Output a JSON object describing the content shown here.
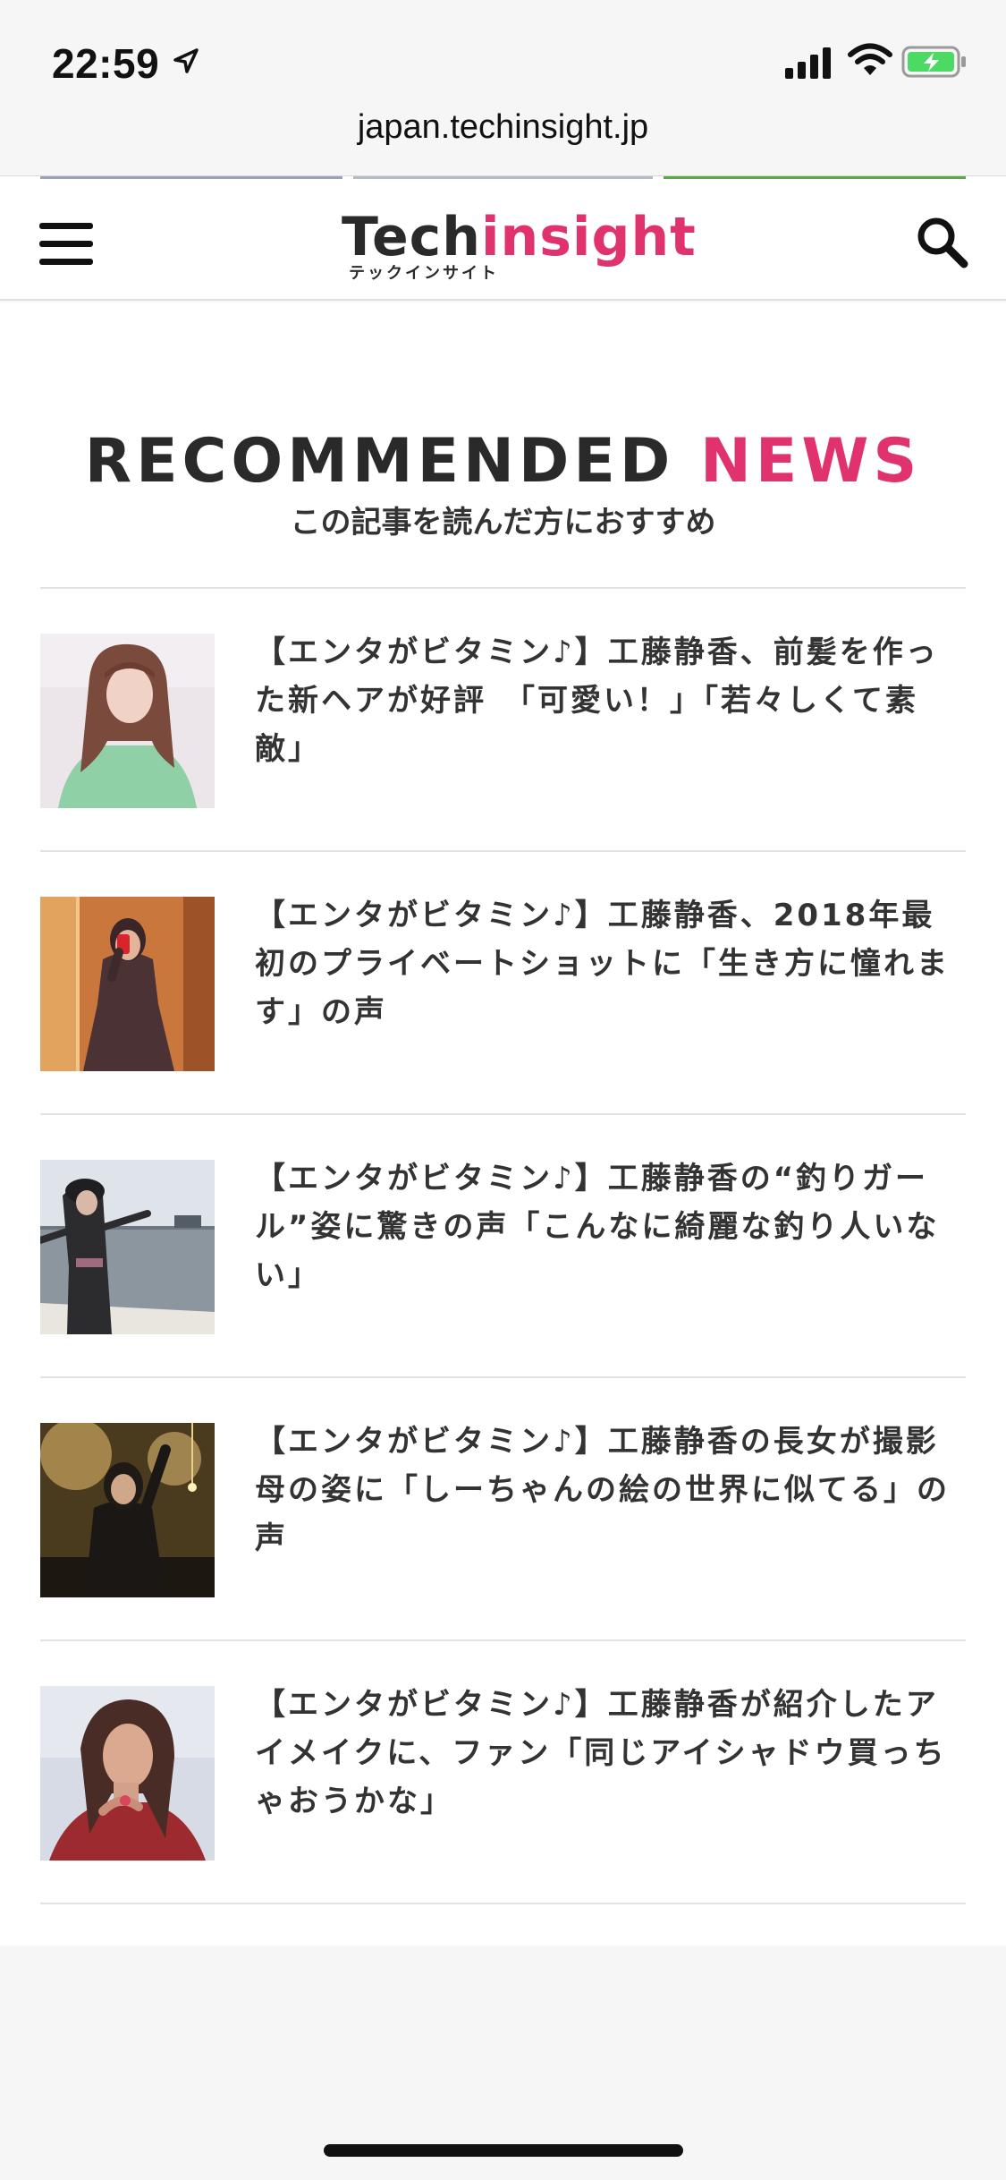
{
  "status_bar": {
    "time": "22:59",
    "icons": [
      "location-arrow-icon",
      "signal-icon",
      "wifi-icon",
      "battery-charging-icon"
    ],
    "battery_color": "#4cd964"
  },
  "browser": {
    "url": "japan.techinsight.jp"
  },
  "header": {
    "logo_main_1": "Tech",
    "logo_main_2": "insight",
    "logo_sub": "テックインサイト",
    "menu_icon": "hamburger-menu-icon",
    "search_icon": "search-icon"
  },
  "colors": {
    "accent": "#e0336e",
    "text": "#222222"
  },
  "section": {
    "title_part1": "RECOMMENDED",
    "title_part2": "NEWS",
    "subtitle": "この記事を読んだ方におすすめ"
  },
  "news": [
    {
      "title": "【エンタがビタミン♪】工藤静香、前髪を作った新ヘアが好評　「可愛い！」「若々しくて素敵」"
    },
    {
      "title": "【エンタがビタミン♪】工藤静香、2018年最初のプライベートショットに「生き方に憧れます」の声"
    },
    {
      "title": "【エンタがビタミン♪】工藤静香の“釣りガール”姿に驚きの声「こんなに綺麗な釣り人いない」"
    },
    {
      "title": "【エンタがビタミン♪】工藤静香の長女が撮影　母の姿に「しーちゃんの絵の世界に似てる」の声"
    },
    {
      "title": "【エンタがビタミン♪】工藤静香が紹介したアイメイクに、ファン「同じアイシャドウ買っちゃおうかな」"
    }
  ]
}
